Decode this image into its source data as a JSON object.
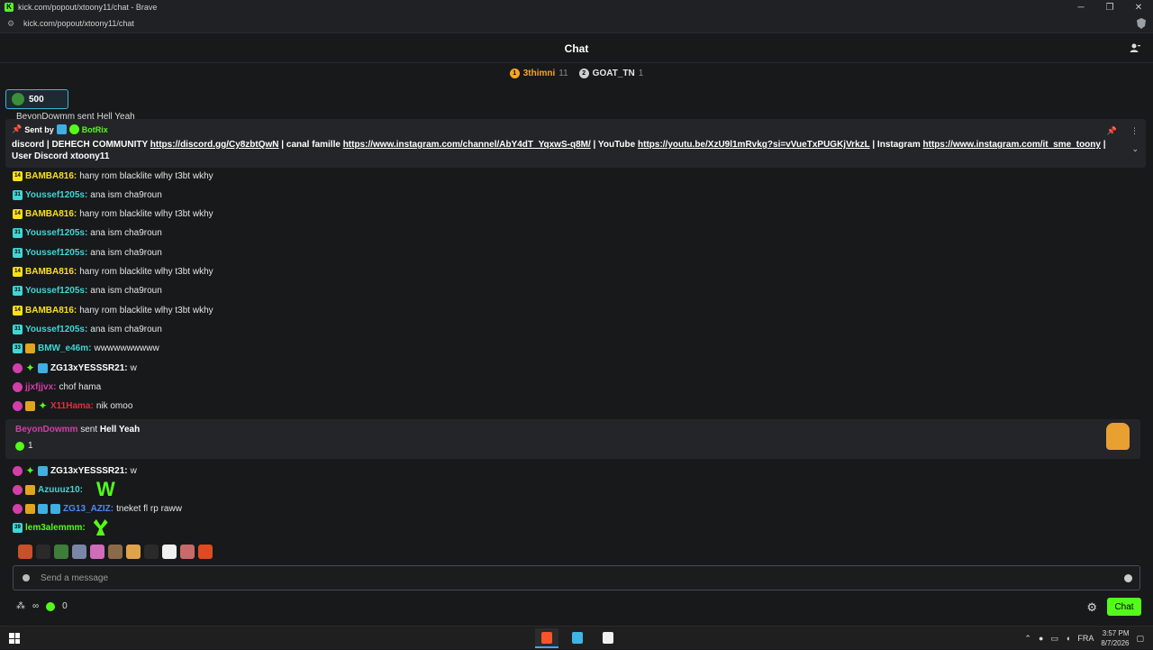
{
  "browser": {
    "title": "kick.com/popout/xtoony11/chat - Brave",
    "url": "kick.com/popout/xtoony11/chat"
  },
  "header": {
    "title": "Chat"
  },
  "leaderboard": [
    {
      "rank": "1",
      "name": "3thimni",
      "count": "11",
      "color": "#f5a623"
    },
    {
      "rank": "2",
      "name": "GOAT_TN",
      "count": "1",
      "color": "#e6e6e6"
    }
  ],
  "gift_pill": {
    "amount": "500"
  },
  "peek_line": "BeyonDowmm sent Hell Yeah",
  "pinned": {
    "sent_by_label": "Sent by",
    "bot_name": "BotRix",
    "segments": [
      {
        "t": "discord | DEHECH COMMUNITY "
      },
      {
        "l": "https://discord.gg/Cy8zbtQwN"
      },
      {
        "t": " | canal famille "
      },
      {
        "l": "https://www.instagram.com/channel/AbY4dT_YqxwS-q8M/"
      },
      {
        "t": " | YouTube "
      },
      {
        "l": "https://youtu.be/XzU9l1mRvkg?si=vVueTxPUGKjVrkzL"
      },
      {
        "t": " | Instagram "
      },
      {
        "l": "https://www.instagram.com/it_sme_toony"
      },
      {
        "t": " | User Discord xtoony11"
      }
    ]
  },
  "messages": [
    {
      "badges": [
        [
          "y",
          "14"
        ]
      ],
      "user": "BAMBA816",
      "color": "#f8e01c",
      "text": "hany rom blacklite wlhy t3bt wkhy"
    },
    {
      "badges": [
        [
          "c",
          "31"
        ]
      ],
      "user": "Youssef1205s",
      "color": "#3fd6d6",
      "text": "ana ism cha9roun"
    },
    {
      "badges": [
        [
          "y",
          "14"
        ]
      ],
      "user": "BAMBA816",
      "color": "#f8e01c",
      "text": "hany rom blacklite wlhy t3bt wkhy"
    },
    {
      "badges": [
        [
          "c",
          "31"
        ]
      ],
      "user": "Youssef1205s",
      "color": "#3fd6d6",
      "text": "ana ism cha9roun"
    },
    {
      "badges": [
        [
          "c",
          "31"
        ]
      ],
      "user": "Youssef1205s",
      "color": "#3fd6d6",
      "text": "ana ism cha9roun"
    },
    {
      "badges": [
        [
          "y",
          "14"
        ]
      ],
      "user": "BAMBA816",
      "color": "#f8e01c",
      "text": "hany rom blacklite wlhy t3bt wkhy"
    },
    {
      "badges": [
        [
          "c",
          "31"
        ]
      ],
      "user": "Youssef1205s",
      "color": "#3fd6d6",
      "text": "ana ism cha9roun"
    },
    {
      "badges": [
        [
          "y",
          "14"
        ]
      ],
      "user": "BAMBA816",
      "color": "#f8e01c",
      "text": "hany rom blacklite wlhy t3bt wkhy"
    },
    {
      "badges": [
        [
          "c",
          "31"
        ]
      ],
      "user": "Youssef1205s",
      "color": "#3fd6d6",
      "text": "ana ism cha9roun"
    },
    {
      "badges": [
        [
          "c",
          "33"
        ],
        [
          "crown",
          ""
        ]
      ],
      "user": "BMW_e46m",
      "color": "#3fd6d6",
      "text": "wwwwwwwwww"
    },
    {
      "badges": [
        [
          "blob",
          ""
        ],
        [
          "star",
          "✦"
        ],
        [
          "bl",
          ""
        ]
      ],
      "user": "ZG13xYESSSR21",
      "color": "#ffffff",
      "text": "w"
    },
    {
      "badges": [
        [
          "blob",
          ""
        ]
      ],
      "user": "jjxfjjvx",
      "color": "#d23fa8",
      "text": "chof hama"
    },
    {
      "badges": [
        [
          "blob",
          ""
        ],
        [
          "crown",
          ""
        ],
        [
          "star",
          "✦"
        ]
      ],
      "user": "X11Hama",
      "color": "#e0303a",
      "text": "nik omoo"
    }
  ],
  "gift_card": {
    "user": "BeyonDowmm",
    "verb": "sent",
    "gift": "Hell Yeah",
    "count": "1"
  },
  "messages_after": [
    {
      "badges": [
        [
          "blob",
          ""
        ],
        [
          "star",
          "✦"
        ],
        [
          "bl",
          ""
        ]
      ],
      "user": "ZG13xYESSSR21",
      "color": "#ffffff",
      "text": "w",
      "big": false
    },
    {
      "badges": [
        [
          "blob",
          ""
        ],
        [
          "crown",
          ""
        ]
      ],
      "user": "Azuuuz10",
      "color": "#3fd6d6",
      "text": "W",
      "big": true
    },
    {
      "badges": [
        [
          "blob",
          ""
        ],
        [
          "crown",
          ""
        ],
        [
          "bl",
          ""
        ],
        [
          "bl",
          ""
        ]
      ],
      "user": "ZG13_AZIZ",
      "color": "#4a8cff",
      "text": "tneket fl rp raww",
      "big": false
    },
    {
      "badges": [
        [
          "c",
          "39"
        ]
      ],
      "user": "lem3alemmm",
      "color": "#53fc18",
      "text": "",
      "big": false
    }
  ],
  "emote_colors": [
    "#c8502a",
    "#2a2a2a",
    "#3e7d3a",
    "#7a86a8",
    "#d06cb8",
    "#8a6a48",
    "#e0a34a",
    "#2a2a2a",
    "#f0f0f0",
    "#c86a6a",
    "#e04a20"
  ],
  "input": {
    "placeholder": "Send a message"
  },
  "footer": {
    "points": "0",
    "chat_button": "Chat",
    "infinity": "∞"
  },
  "taskbar": {
    "lang": "FRA",
    "time": "3:57 PM",
    "date": "8/7/2026"
  },
  "colors": {
    "accent": "#53fc18",
    "bg": "#18191b"
  }
}
